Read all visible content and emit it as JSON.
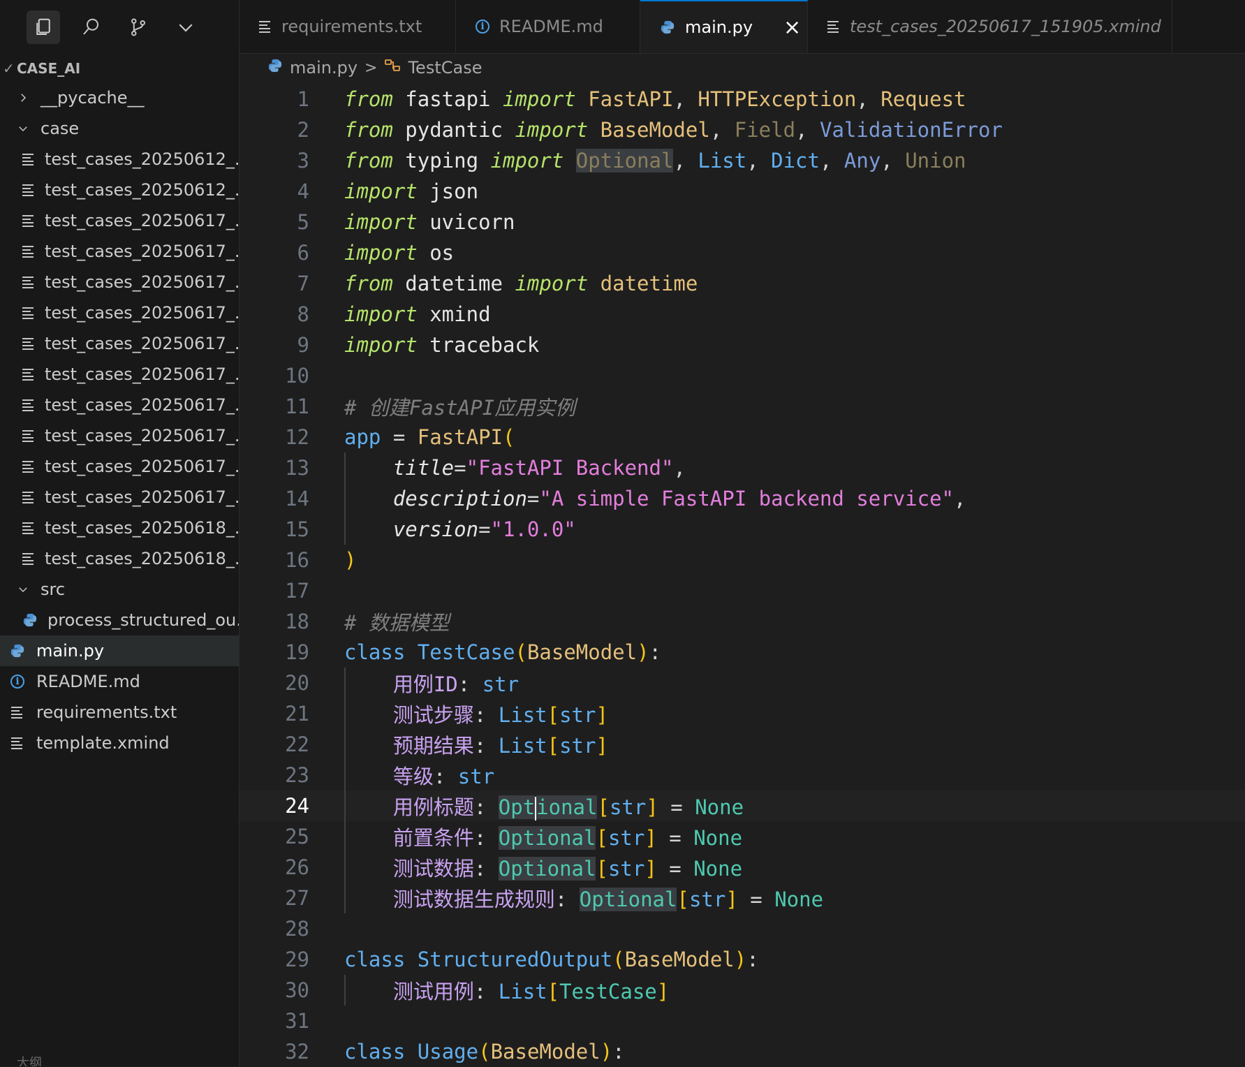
{
  "explorer": {
    "root": "CASE_AI",
    "items": [
      {
        "label": "__pycache__",
        "kind": "folder",
        "expanded": false,
        "depth": 0
      },
      {
        "label": "case",
        "kind": "folder",
        "expanded": true,
        "depth": 0
      },
      {
        "label": "test_cases_20250612_...",
        "kind": "file",
        "depth": 1
      },
      {
        "label": "test_cases_20250612_...",
        "kind": "file",
        "depth": 1
      },
      {
        "label": "test_cases_20250617_...",
        "kind": "file",
        "depth": 1
      },
      {
        "label": "test_cases_20250617_...",
        "kind": "file",
        "depth": 1
      },
      {
        "label": "test_cases_20250617_...",
        "kind": "file",
        "depth": 1
      },
      {
        "label": "test_cases_20250617_...",
        "kind": "file",
        "depth": 1
      },
      {
        "label": "test_cases_20250617_...",
        "kind": "file",
        "depth": 1
      },
      {
        "label": "test_cases_20250617_...",
        "kind": "file",
        "depth": 1
      },
      {
        "label": "test_cases_20250617_...",
        "kind": "file",
        "depth": 1
      },
      {
        "label": "test_cases_20250617_...",
        "kind": "file",
        "depth": 1
      },
      {
        "label": "test_cases_20250617_...",
        "kind": "file",
        "depth": 1
      },
      {
        "label": "test_cases_20250617_...",
        "kind": "file",
        "depth": 1
      },
      {
        "label": "test_cases_20250618_...",
        "kind": "file",
        "depth": 1
      },
      {
        "label": "test_cases_20250618_...",
        "kind": "file",
        "depth": 1
      },
      {
        "label": "src",
        "kind": "folder",
        "expanded": true,
        "depth": 0
      },
      {
        "label": "process_structured_ou...",
        "kind": "python",
        "depth": 1
      },
      {
        "label": "main.py",
        "kind": "python",
        "depth": 0,
        "selected": true
      },
      {
        "label": "README.md",
        "kind": "info",
        "depth": 0
      },
      {
        "label": "requirements.txt",
        "kind": "file",
        "depth": 0
      },
      {
        "label": "template.xmind",
        "kind": "file",
        "depth": 0
      }
    ],
    "outline_stub": "大纲"
  },
  "tabs": [
    {
      "label": "requirements.txt",
      "icon": "lines-icon",
      "active": false
    },
    {
      "label": "README.md",
      "icon": "info-icon",
      "active": false
    },
    {
      "label": "main.py",
      "icon": "python-icon",
      "active": true,
      "close": "×"
    },
    {
      "label": "test_cases_20250617_151905.xmind",
      "icon": "lines-icon",
      "active": false,
      "italic": true
    }
  ],
  "breadcrumb": {
    "file": "main.py",
    "separator": ">",
    "symbol": "TestCase"
  },
  "editor": {
    "current_line": 24,
    "lines": [
      {
        "n": "1",
        "t": [
          [
            "kwf",
            "from"
          ],
          [
            "mod",
            " fastapi "
          ],
          [
            "kwf",
            "import"
          ],
          [
            "cls",
            " FastAPI"
          ],
          [
            "plain",
            ", "
          ],
          [
            "cls",
            "HTTPException"
          ],
          [
            "plain",
            ", "
          ],
          [
            "cls",
            "Request"
          ]
        ]
      },
      {
        "n": "2",
        "t": [
          [
            "kwf",
            "from"
          ],
          [
            "mod",
            " pydantic "
          ],
          [
            "kwf",
            "import"
          ],
          [
            "cls",
            " BaseModel"
          ],
          [
            "plain",
            ", "
          ],
          [
            "dim",
            "Field"
          ],
          [
            "plain",
            ", "
          ],
          [
            "val",
            "ValidationError"
          ]
        ]
      },
      {
        "n": "3",
        "t": [
          [
            "kwf",
            "from"
          ],
          [
            "mod",
            " typing "
          ],
          [
            "kwf",
            "import"
          ],
          [
            "plain",
            " "
          ],
          [
            "dim hl",
            "Optional"
          ],
          [
            "plain",
            ", "
          ],
          [
            "clsb",
            "List"
          ],
          [
            "plain",
            ", "
          ],
          [
            "clsb",
            "Dict"
          ],
          [
            "plain",
            ", "
          ],
          [
            "val",
            "Any"
          ],
          [
            "plain",
            ", "
          ],
          [
            "dim",
            "Union"
          ]
        ]
      },
      {
        "n": "4",
        "t": [
          [
            "kwf",
            "import"
          ],
          [
            "mod",
            " json"
          ]
        ]
      },
      {
        "n": "5",
        "t": [
          [
            "kwf",
            "import"
          ],
          [
            "mod",
            " uvicorn"
          ]
        ]
      },
      {
        "n": "6",
        "t": [
          [
            "kwf",
            "import"
          ],
          [
            "mod",
            " os"
          ]
        ]
      },
      {
        "n": "7",
        "t": [
          [
            "kwf",
            "from"
          ],
          [
            "mod",
            " datetime "
          ],
          [
            "kwf",
            "import"
          ],
          [
            "cls",
            " datetime"
          ]
        ]
      },
      {
        "n": "8",
        "t": [
          [
            "kwf",
            "import"
          ],
          [
            "mod",
            " xmind"
          ]
        ]
      },
      {
        "n": "9",
        "t": [
          [
            "kwf",
            "import"
          ],
          [
            "mod",
            " traceback"
          ]
        ]
      },
      {
        "n": "10",
        "t": []
      },
      {
        "n": "11",
        "t": [
          [
            "cm",
            "# 创建FastAPI应用实例"
          ]
        ]
      },
      {
        "n": "12",
        "t": [
          [
            "var",
            "app"
          ],
          [
            "plain",
            " = "
          ],
          [
            "fn",
            "FastAPI"
          ],
          [
            "par",
            "("
          ]
        ]
      },
      {
        "n": "13",
        "g": true,
        "t": [
          [
            "plain",
            "    "
          ],
          [
            "arg",
            "title"
          ],
          [
            "plain",
            "="
          ],
          [
            "str",
            "\"FastAPI Backend\""
          ],
          [
            "plain",
            ","
          ]
        ]
      },
      {
        "n": "14",
        "g": true,
        "t": [
          [
            "plain",
            "    "
          ],
          [
            "arg",
            "description"
          ],
          [
            "plain",
            "="
          ],
          [
            "str",
            "\"A simple FastAPI backend service\""
          ],
          [
            "plain",
            ","
          ]
        ]
      },
      {
        "n": "15",
        "g": true,
        "t": [
          [
            "plain",
            "    "
          ],
          [
            "arg",
            "version"
          ],
          [
            "plain",
            "="
          ],
          [
            "str",
            "\"1.0.0\""
          ]
        ]
      },
      {
        "n": "16",
        "t": [
          [
            "par",
            ")"
          ]
        ]
      },
      {
        "n": "17",
        "t": []
      },
      {
        "n": "18",
        "t": [
          [
            "cm",
            "# 数据模型"
          ]
        ]
      },
      {
        "n": "19",
        "t": [
          [
            "typ",
            "class"
          ],
          [
            "plain",
            " "
          ],
          [
            "var",
            "TestCase"
          ],
          [
            "par",
            "("
          ],
          [
            "cls",
            "BaseModel"
          ],
          [
            "par",
            ")"
          ],
          [
            "plain",
            ":"
          ]
        ]
      },
      {
        "n": "20",
        "g": true,
        "t": [
          [
            "plain",
            "    "
          ],
          [
            "field",
            "用例ID"
          ],
          [
            "plain",
            ": "
          ],
          [
            "typ",
            "str"
          ]
        ]
      },
      {
        "n": "21",
        "g": true,
        "t": [
          [
            "plain",
            "    "
          ],
          [
            "field",
            "测试步骤"
          ],
          [
            "plain",
            ": "
          ],
          [
            "typ",
            "List"
          ],
          [
            "brk",
            "["
          ],
          [
            "typ",
            "str"
          ],
          [
            "brk",
            "]"
          ]
        ]
      },
      {
        "n": "22",
        "g": true,
        "t": [
          [
            "plain",
            "    "
          ],
          [
            "field",
            "预期结果"
          ],
          [
            "plain",
            ": "
          ],
          [
            "typ",
            "List"
          ],
          [
            "brk",
            "["
          ],
          [
            "typ",
            "str"
          ],
          [
            "brk",
            "]"
          ]
        ]
      },
      {
        "n": "23",
        "g": true,
        "t": [
          [
            "plain",
            "    "
          ],
          [
            "field",
            "等级"
          ],
          [
            "plain",
            ": "
          ],
          [
            "typ",
            "str"
          ]
        ]
      },
      {
        "n": "24",
        "g": true,
        "cur": true,
        "t": [
          [
            "plain",
            "    "
          ],
          [
            "field",
            "用例标题"
          ],
          [
            "plain",
            ": "
          ],
          [
            "none hl",
            "Opt"
          ],
          [
            "cursor",
            ""
          ],
          [
            "none hl",
            "ional"
          ],
          [
            "brk",
            "["
          ],
          [
            "typ",
            "str"
          ],
          [
            "brk",
            "]"
          ],
          [
            "plain",
            " = "
          ],
          [
            "none",
            "None"
          ]
        ]
      },
      {
        "n": "25",
        "g": true,
        "t": [
          [
            "plain",
            "    "
          ],
          [
            "field",
            "前置条件"
          ],
          [
            "plain",
            ": "
          ],
          [
            "none hl",
            "Optional"
          ],
          [
            "brk",
            "["
          ],
          [
            "typ",
            "str"
          ],
          [
            "brk",
            "]"
          ],
          [
            "plain",
            " = "
          ],
          [
            "none",
            "None"
          ]
        ]
      },
      {
        "n": "26",
        "g": true,
        "t": [
          [
            "plain",
            "    "
          ],
          [
            "field",
            "测试数据"
          ],
          [
            "plain",
            ": "
          ],
          [
            "none hl",
            "Optional"
          ],
          [
            "brk",
            "["
          ],
          [
            "typ",
            "str"
          ],
          [
            "brk",
            "]"
          ],
          [
            "plain",
            " = "
          ],
          [
            "none",
            "None"
          ]
        ]
      },
      {
        "n": "27",
        "g": true,
        "t": [
          [
            "plain",
            "    "
          ],
          [
            "field",
            "测试数据生成规则"
          ],
          [
            "plain",
            ": "
          ],
          [
            "none hl",
            "Optional"
          ],
          [
            "brk",
            "["
          ],
          [
            "typ",
            "str"
          ],
          [
            "brk",
            "]"
          ],
          [
            "plain",
            " = "
          ],
          [
            "none",
            "None"
          ]
        ]
      },
      {
        "n": "28",
        "t": []
      },
      {
        "n": "29",
        "t": [
          [
            "typ",
            "class"
          ],
          [
            "plain",
            " "
          ],
          [
            "var",
            "StructuredOutput"
          ],
          [
            "par",
            "("
          ],
          [
            "cls",
            "BaseModel"
          ],
          [
            "par",
            ")"
          ],
          [
            "plain",
            ":"
          ]
        ]
      },
      {
        "n": "30",
        "g": true,
        "t": [
          [
            "plain",
            "    "
          ],
          [
            "field",
            "测试用例"
          ],
          [
            "plain",
            ": "
          ],
          [
            "typ",
            "List"
          ],
          [
            "brk",
            "["
          ],
          [
            "none",
            "TestCase"
          ],
          [
            "brk",
            "]"
          ]
        ]
      },
      {
        "n": "31",
        "t": []
      },
      {
        "n": "32",
        "t": [
          [
            "typ",
            "class"
          ],
          [
            "plain",
            " "
          ],
          [
            "var",
            "Usage"
          ],
          [
            "par",
            "("
          ],
          [
            "cls",
            "BaseModel"
          ],
          [
            "par",
            ")"
          ],
          [
            "plain",
            ":"
          ]
        ]
      }
    ]
  }
}
